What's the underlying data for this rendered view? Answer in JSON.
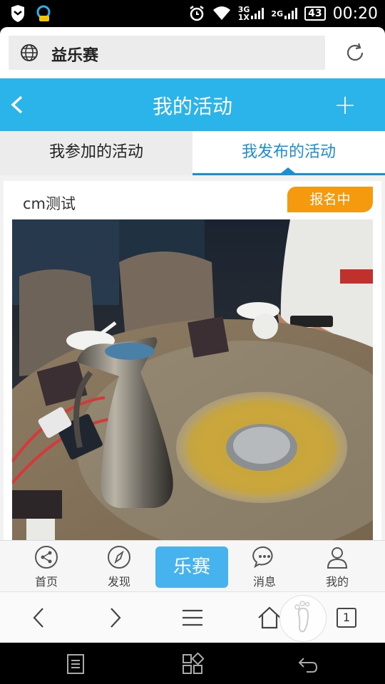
{
  "status_bar": {
    "network_top": "3G",
    "network_bottom": "1X",
    "network_2g": "2G",
    "battery": "43",
    "time": "00:20"
  },
  "address_bar": {
    "url_text": "益乐赛"
  },
  "title_bar": {
    "title": "我的活动",
    "add_label": "+"
  },
  "tabs": [
    {
      "label": "我参加的活动",
      "active": false
    },
    {
      "label": "我发布的活动",
      "active": true
    }
  ],
  "activity": {
    "title": "cm测试",
    "status": "报名中"
  },
  "bottom_nav": {
    "items": [
      {
        "label": "首页",
        "icon": "share-icon"
      },
      {
        "label": "发现",
        "icon": "compass-icon"
      },
      {
        "label": "乐赛",
        "icon": ""
      },
      {
        "label": "消息",
        "icon": "chat-icon"
      },
      {
        "label": "我的",
        "icon": "person-icon"
      }
    ]
  },
  "browser_toolbar": {
    "tab_count": "1"
  },
  "colors": {
    "accent": "#2ab4e9",
    "active_tab": "#1a8fd6",
    "status_badge": "#f59a0e",
    "center_nav": "#47b3ee"
  }
}
